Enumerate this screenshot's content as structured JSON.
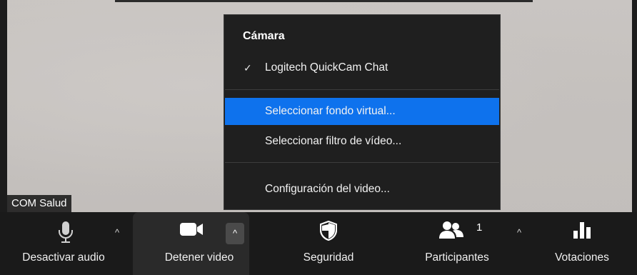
{
  "video": {
    "participant_name": "COM Salud"
  },
  "menu": {
    "heading": "Cámara",
    "items": [
      {
        "label": "Logitech QuickCam Chat",
        "checked": true,
        "selected": false
      },
      {
        "label": "Seleccionar fondo virtual...",
        "checked": false,
        "selected": true
      },
      {
        "label": "Seleccionar filtro de vídeo...",
        "checked": false,
        "selected": false
      },
      {
        "label": "Configuración del video...",
        "checked": false,
        "selected": false
      }
    ],
    "check_glyph": "✓"
  },
  "toolbar": {
    "audio_label": "Desactivar audio",
    "video_label": "Detener video",
    "security_label": "Seguridad",
    "participants_label": "Participantes",
    "participants_count": "1",
    "polls_label": "Votaciones",
    "caret_glyph": "^"
  },
  "colors": {
    "menu_bg": "#1f1f1f",
    "selected": "#0e72ed",
    "toolbar_bg": "#1a1a1a"
  }
}
